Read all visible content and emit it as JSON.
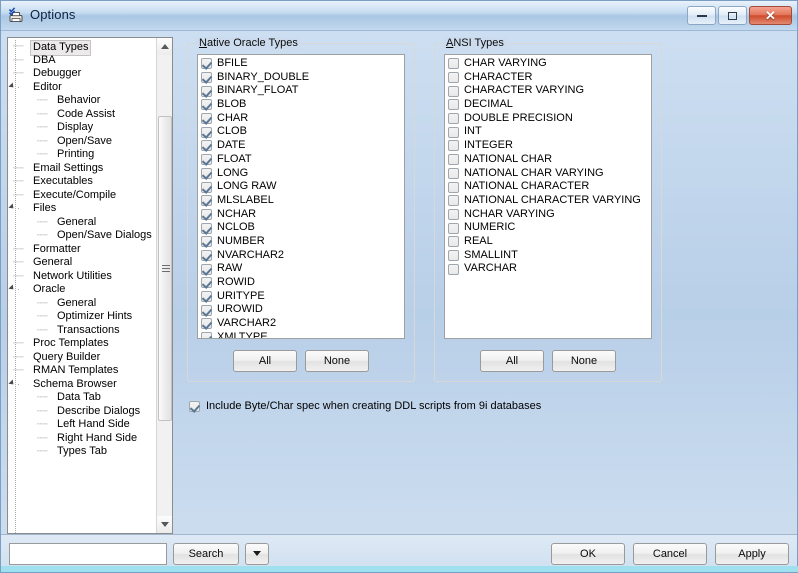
{
  "window": {
    "title": "Options",
    "icon": "options-printer-icon",
    "controls": {
      "minimize": "minimize-icon",
      "maximize": "maximize-icon",
      "close": "close-icon",
      "close_glyph": "✕"
    }
  },
  "sidebar": {
    "selected": "Data Types",
    "items": [
      {
        "label": "Data Types",
        "level": 1,
        "expander": "none",
        "selected": true
      },
      {
        "label": "DBA",
        "level": 1,
        "expander": "none",
        "selected": false
      },
      {
        "label": "Debugger",
        "level": 1,
        "expander": "none",
        "selected": false
      },
      {
        "label": "Editor",
        "level": 1,
        "expander": "expanded",
        "selected": false
      },
      {
        "label": "Behavior",
        "level": 2,
        "expander": "none",
        "selected": false
      },
      {
        "label": "Code Assist",
        "level": 2,
        "expander": "none",
        "selected": false
      },
      {
        "label": "Display",
        "level": 2,
        "expander": "none",
        "selected": false
      },
      {
        "label": "Open/Save",
        "level": 2,
        "expander": "none",
        "selected": false
      },
      {
        "label": "Printing",
        "level": 2,
        "expander": "none",
        "selected": false
      },
      {
        "label": "Email Settings",
        "level": 1,
        "expander": "none",
        "selected": false
      },
      {
        "label": "Executables",
        "level": 1,
        "expander": "none",
        "selected": false
      },
      {
        "label": "Execute/Compile",
        "level": 1,
        "expander": "none",
        "selected": false
      },
      {
        "label": "Files",
        "level": 1,
        "expander": "expanded",
        "selected": false
      },
      {
        "label": "General",
        "level": 2,
        "expander": "none",
        "selected": false
      },
      {
        "label": "Open/Save Dialogs",
        "level": 2,
        "expander": "none",
        "selected": false
      },
      {
        "label": "Formatter",
        "level": 1,
        "expander": "none",
        "selected": false
      },
      {
        "label": "General",
        "level": 1,
        "expander": "none",
        "selected": false
      },
      {
        "label": "Network Utilities",
        "level": 1,
        "expander": "none",
        "selected": false
      },
      {
        "label": "Oracle",
        "level": 1,
        "expander": "expanded",
        "selected": false
      },
      {
        "label": "General",
        "level": 2,
        "expander": "none",
        "selected": false
      },
      {
        "label": "Optimizer Hints",
        "level": 2,
        "expander": "none",
        "selected": false
      },
      {
        "label": "Transactions",
        "level": 2,
        "expander": "none",
        "selected": false
      },
      {
        "label": "Proc Templates",
        "level": 1,
        "expander": "none",
        "selected": false
      },
      {
        "label": "Query Builder",
        "level": 1,
        "expander": "none",
        "selected": false
      },
      {
        "label": "RMAN Templates",
        "level": 1,
        "expander": "none",
        "selected": false
      },
      {
        "label": "Schema Browser",
        "level": 1,
        "expander": "expanded",
        "selected": false
      },
      {
        "label": "Data Tab",
        "level": 2,
        "expander": "none",
        "selected": false
      },
      {
        "label": "Describe Dialogs",
        "level": 2,
        "expander": "none",
        "selected": false
      },
      {
        "label": "Left Hand Side",
        "level": 2,
        "expander": "none",
        "selected": false
      },
      {
        "label": "Right Hand Side",
        "level": 2,
        "expander": "none",
        "selected": false
      },
      {
        "label": "Types Tab",
        "level": 2,
        "expander": "none",
        "selected": false
      }
    ],
    "scrollbar": {
      "up_arrow": "scroll-up-icon",
      "down_arrow": "scroll-down-icon"
    }
  },
  "native_group": {
    "title_accel": "N",
    "title_rest": "ative Oracle Types",
    "items": [
      {
        "label": "BFILE",
        "checked": true
      },
      {
        "label": "BINARY_DOUBLE",
        "checked": true
      },
      {
        "label": "BINARY_FLOAT",
        "checked": true
      },
      {
        "label": "BLOB",
        "checked": true
      },
      {
        "label": "CHAR",
        "checked": true
      },
      {
        "label": "CLOB",
        "checked": true
      },
      {
        "label": "DATE",
        "checked": true
      },
      {
        "label": "FLOAT",
        "checked": true
      },
      {
        "label": "LONG",
        "checked": true
      },
      {
        "label": "LONG RAW",
        "checked": true
      },
      {
        "label": "MLSLABEL",
        "checked": true
      },
      {
        "label": "NCHAR",
        "checked": true
      },
      {
        "label": "NCLOB",
        "checked": true
      },
      {
        "label": "NUMBER",
        "checked": true
      },
      {
        "label": "NVARCHAR2",
        "checked": true
      },
      {
        "label": "RAW",
        "checked": true
      },
      {
        "label": "ROWID",
        "checked": true
      },
      {
        "label": "URITYPE",
        "checked": true
      },
      {
        "label": "UROWID",
        "checked": true
      },
      {
        "label": "VARCHAR2",
        "checked": true
      },
      {
        "label": "XMLTYPE",
        "checked": true
      }
    ],
    "all_label": "All",
    "none_label": "None"
  },
  "ansi_group": {
    "title_accel": "A",
    "title_rest": "NSI Types",
    "items": [
      {
        "label": "CHAR VARYING",
        "checked": false
      },
      {
        "label": "CHARACTER",
        "checked": false
      },
      {
        "label": "CHARACTER VARYING",
        "checked": false
      },
      {
        "label": "DECIMAL",
        "checked": false
      },
      {
        "label": "DOUBLE PRECISION",
        "checked": false
      },
      {
        "label": "INT",
        "checked": false
      },
      {
        "label": "INTEGER",
        "checked": false
      },
      {
        "label": "NATIONAL CHAR",
        "checked": false
      },
      {
        "label": "NATIONAL CHAR VARYING",
        "checked": false
      },
      {
        "label": "NATIONAL CHARACTER",
        "checked": false
      },
      {
        "label": "NATIONAL CHARACTER VARYING",
        "checked": false
      },
      {
        "label": "NCHAR VARYING",
        "checked": false
      },
      {
        "label": "NUMERIC",
        "checked": false
      },
      {
        "label": "REAL",
        "checked": false
      },
      {
        "label": "SMALLINT",
        "checked": false
      },
      {
        "label": "VARCHAR",
        "checked": false
      }
    ],
    "all_label": "All",
    "none_label": "None"
  },
  "ddl_option": {
    "label": "Include Byte/Char spec when creating DDL scripts from 9i databases",
    "checked": true
  },
  "footer": {
    "search_value": "",
    "search_placeholder": "",
    "search_label": "Search",
    "search_dropdown": "chevron-down-icon",
    "ok_label": "OK",
    "cancel_label": "Cancel",
    "apply_label": "Apply"
  },
  "colors": {
    "window_chrome": "#cfdff0",
    "titlebar": "#a9c6e4",
    "close_button": "#cf4b2c",
    "listbox_bg": "#ffffff",
    "check_mark": "#5a7795",
    "bottom_strip": "#9fe0ef"
  }
}
